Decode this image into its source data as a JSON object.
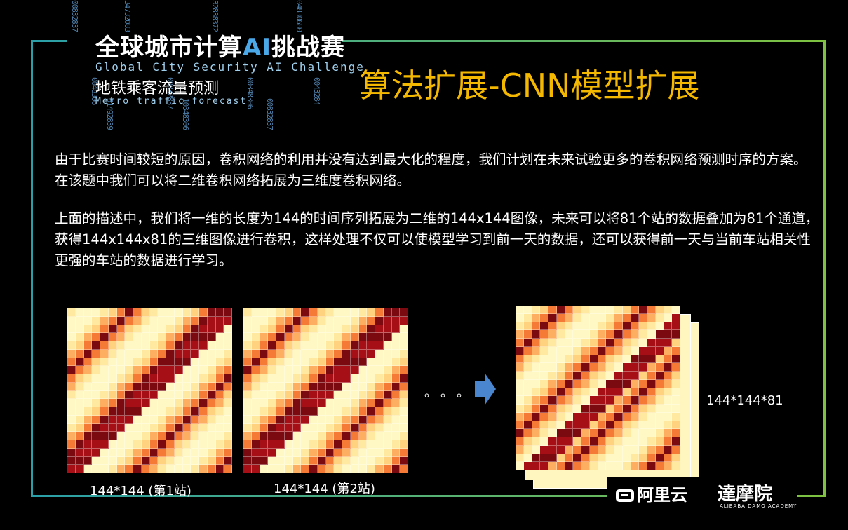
{
  "header": {
    "cn_title_pre": "全球城市计算",
    "cn_title_ai": "AI",
    "cn_title_post": "挑战赛",
    "en_title": "Global City Security AI Challenge",
    "cn_subtitle": "地铁乘客流量预测",
    "en_subtitle": "Metro traffic forecast",
    "code_rain": [
      "00832837",
      "0048306",
      "51492839",
      "34732083",
      "00832837",
      "10348306",
      "32838372",
      "00348306",
      "00832837",
      "04830680",
      "0043284"
    ]
  },
  "slide": {
    "title": "算法扩展-CNN模型扩展",
    "paragraph1": "由于比赛时间较短的原因，卷积网络的利用并没有达到最大化的程度，我们计划在未来试验更多的卷积网络预测时序的方案。在该题中我们可以将二维卷积网络拓展为三维度卷积网络。",
    "paragraph2": "上面的描述中，我们将一维的长度为144的时间序列拓展为二维的144x144图像，未来可以将81个站的数据叠加为81个通道，获得144x144x81的三维图像进行卷积，这样处理不仅可以使模型学习到前一天的数据，还可以获得前一天与当前车站相关性更强的车站的数据进行学习。"
  },
  "figure": {
    "caption1": "144*144 (第1站)",
    "caption2": "144*144 (第2站)",
    "caption3": "144*144*81",
    "ellipsis": "。。。",
    "heatmap_colors": [
      "#fff7c4",
      "#ffe9a1",
      "#fed27f",
      "#fdae61",
      "#f57a35",
      "#d9431f",
      "#a50f15",
      "#7a0a10"
    ]
  },
  "logos": {
    "alibaba_cloud": "阿里云",
    "damo": "達摩院",
    "damo_en": "ALIBABA DAMO ACADEMY"
  }
}
